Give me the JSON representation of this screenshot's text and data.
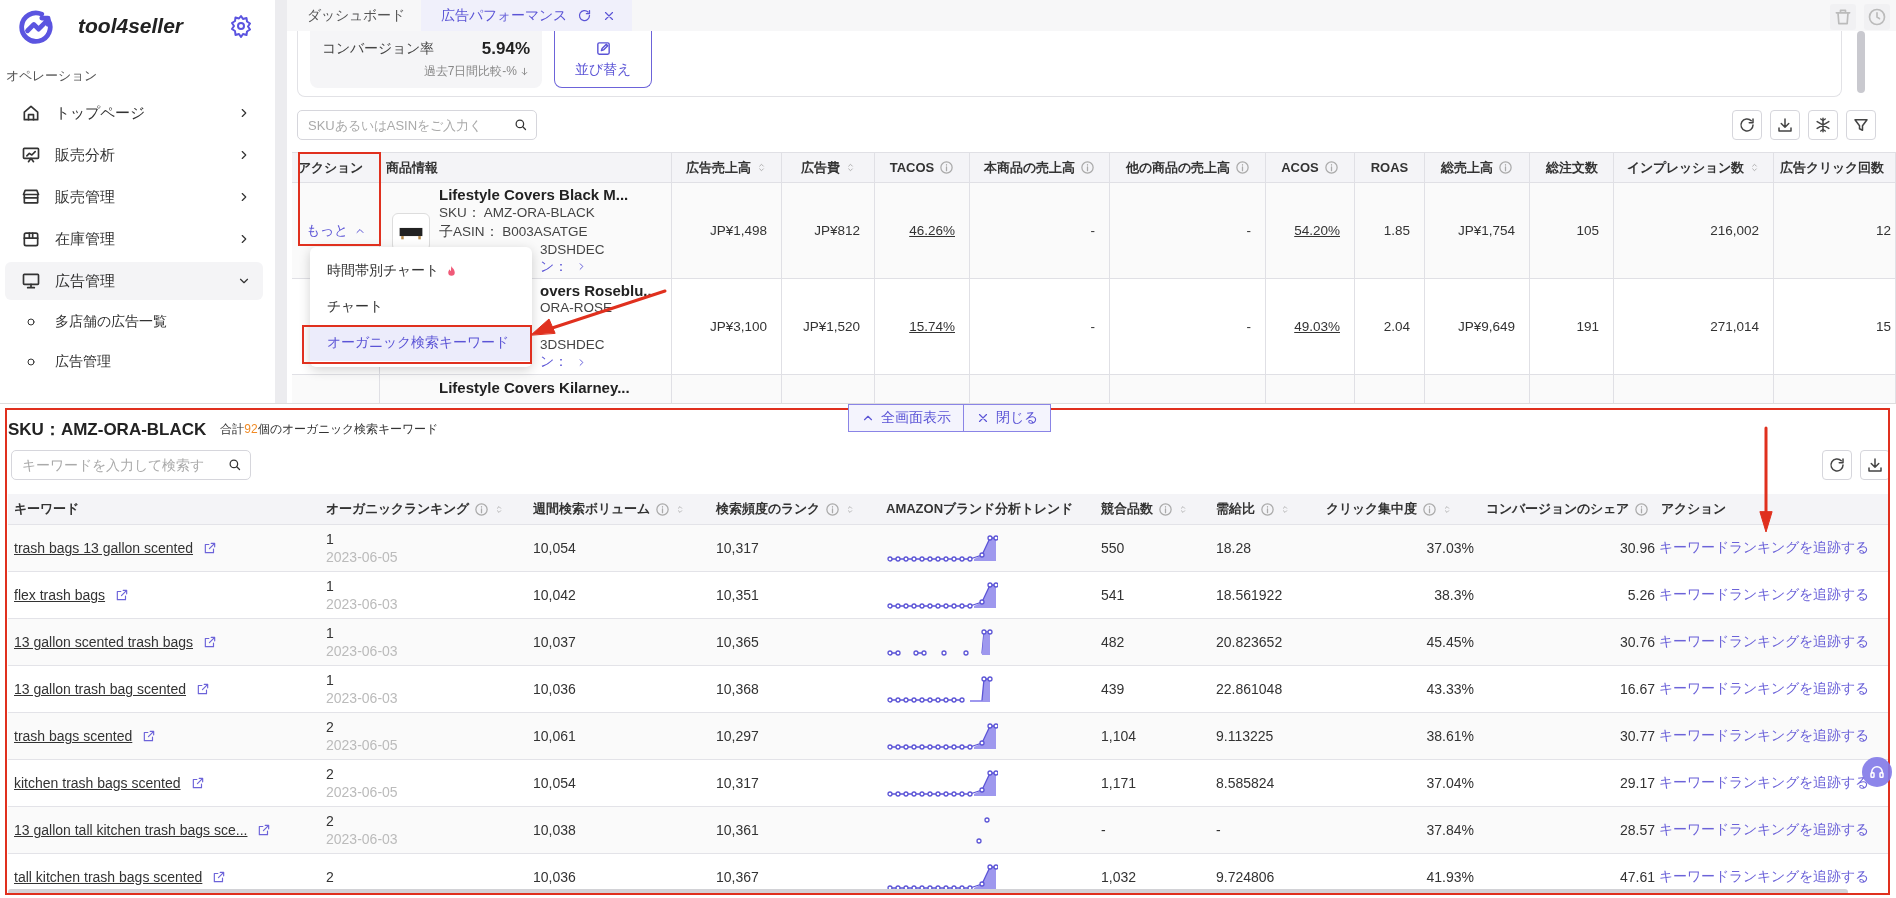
{
  "sidebar": {
    "brand": "tool4seller",
    "section": "オペレーション",
    "items": [
      {
        "label": "トップページ",
        "expanded": false
      },
      {
        "label": "販売分析",
        "expanded": false
      },
      {
        "label": "販売管理",
        "expanded": false
      },
      {
        "label": "在庫管理",
        "expanded": false
      },
      {
        "label": "広告管理",
        "expanded": true,
        "children": [
          {
            "label": "多店舗の広告一覧"
          },
          {
            "label": "広告管理"
          }
        ]
      }
    ]
  },
  "tabs": [
    {
      "label": "ダッシュボード",
      "selected": false
    },
    {
      "label": "広告パフォーマンス",
      "selected": true
    }
  ],
  "metric": {
    "label": "コンバージョン率",
    "value": "5.94%",
    "comparison": "過去7日間比較-%"
  },
  "sort_button": "並び替え",
  "search": {
    "placeholder": "SKUあるいはASINをご入力く"
  },
  "ads_table": {
    "columns": [
      {
        "label": "アクション",
        "info": false,
        "sortable": false
      },
      {
        "label": "商品情報",
        "info": false,
        "sortable": false
      },
      {
        "label": "広告売上高",
        "info": false,
        "sortable": true
      },
      {
        "label": "広告費",
        "info": false,
        "sortable": true
      },
      {
        "label": "TACOS",
        "info": true,
        "sortable": false,
        "linked": true
      },
      {
        "label": "本商品の売上高",
        "info": true,
        "sortable": false
      },
      {
        "label": "他の商品の売上高",
        "info": true,
        "sortable": false
      },
      {
        "label": "ACOS",
        "info": true,
        "sortable": false,
        "linked": true
      },
      {
        "label": "ROAS",
        "info": false,
        "sortable": false
      },
      {
        "label": "総売上高",
        "info": true,
        "sortable": false
      },
      {
        "label": "総注文数",
        "info": false,
        "sortable": false
      },
      {
        "label": "インプレッション数",
        "info": false,
        "sortable": true
      },
      {
        "label": "広告クリック回数",
        "info": false,
        "sortable": false
      }
    ],
    "rows": [
      {
        "action": "もっと",
        "expanded": true,
        "photo": true,
        "lines": [
          {
            "text": "Lifestyle Covers Black M...",
            "kind": "title"
          },
          {
            "text": "SKU： AMZ-ORA-BLACK",
            "kind": "full"
          },
          {
            "text": "子ASIN： B003ASATGE",
            "kind": "full"
          },
          {
            "text": "3DSHDEC",
            "kind": "tail"
          },
          {
            "text": "ン：",
            "kind": "tail-link"
          }
        ],
        "cells": [
          "JP¥1,498",
          "JP¥812",
          "46.26%",
          "-",
          "-",
          "54.20%",
          "1.85",
          "JP¥1,754",
          "105",
          "216,002",
          "12"
        ]
      },
      {
        "lines": [
          {
            "text": "overs Roseblu...",
            "kind": "tail-title"
          },
          {
            "text": "ORA-ROSE",
            "kind": "tail"
          },
          {
            "kind": "covered"
          },
          {
            "text": "3DSHDEC",
            "kind": "tail"
          },
          {
            "text": "ン：",
            "kind": "tail-link"
          }
        ],
        "cells": [
          "JP¥3,100",
          "JP¥1,520",
          "15.74%",
          "-",
          "-",
          "49.03%",
          "2.04",
          "JP¥9,649",
          "191",
          "271,014",
          "15"
        ]
      },
      {
        "lines": [
          {
            "text": "Lifestyle Covers Kilarney...",
            "kind": "title"
          }
        ]
      }
    ]
  },
  "row_menu": {
    "items": [
      {
        "label": "時間帯別チャート",
        "hot": true,
        "selected": false
      },
      {
        "label": "チャート",
        "hot": false,
        "selected": false
      },
      {
        "label": "オーガニック検索キーワード",
        "hot": false,
        "selected": true
      }
    ]
  },
  "keyword_panel": {
    "title": "SKU：AMZ-ORA-BLACK",
    "summary_prefix": "合計",
    "count": "92",
    "summary_suffix": "個のオーガニック検索キーワード",
    "buttons": [
      {
        "label": "全画面表示",
        "kind": "expand"
      },
      {
        "label": "閉じる",
        "kind": "close"
      }
    ],
    "search": {
      "placeholder": "キーワードを入力して検索す"
    },
    "columns": [
      {
        "label": "キーワード",
        "info": false,
        "sortable": false
      },
      {
        "label": "オーガニックランキング",
        "info": true,
        "sortable": true
      },
      {
        "label": "週間検索ボリューム",
        "info": true,
        "sortable": true
      },
      {
        "label": "検索頻度のランク",
        "info": true,
        "sortable": true
      },
      {
        "label": "AMAZONブランド分析トレンド",
        "info": false,
        "sortable": false
      },
      {
        "label": "競合品数",
        "info": true,
        "sortable": true
      },
      {
        "label": "需給比",
        "info": true,
        "sortable": true
      },
      {
        "label": "クリック集中度",
        "info": true,
        "sortable": true
      },
      {
        "label": "コンバージョンのシェア",
        "info": true,
        "sortable": false
      },
      {
        "label": "アクション",
        "info": false,
        "sortable": false
      }
    ],
    "rows": [
      {
        "keyword": "trash bags 13 gallon scented",
        "rank": "1",
        "date": "2023-06-05",
        "weekly_volume": "10,054",
        "frequency_rank": "10,317",
        "kind": "rise",
        "competitors": "550",
        "supply_demand": "18.28",
        "click_concentration": "37.03%",
        "conversion_share": "30.96",
        "action": "キーワードランキングを追跡する"
      },
      {
        "keyword": "flex trash bags",
        "rank": "1",
        "date": "2023-06-03",
        "weekly_volume": "10,042",
        "frequency_rank": "10,351",
        "kind": "rise",
        "competitors": "541",
        "supply_demand": "18.561922",
        "click_concentration": "38.3%",
        "conversion_share": "5.26",
        "action": "キーワードランキングを追跡する"
      },
      {
        "keyword": "13 gallon scented trash bags",
        "rank": "1",
        "date": "2023-06-03",
        "weekly_volume": "10,037",
        "frequency_rank": "10,365",
        "kind": "gaps",
        "competitors": "482",
        "supply_demand": "20.823652",
        "click_concentration": "45.45%",
        "conversion_share": "30.76",
        "action": "キーワードランキングを追跡する"
      },
      {
        "keyword": "13 gallon trash bag scented",
        "rank": "1",
        "date": "2023-06-03",
        "weekly_volume": "10,036",
        "frequency_rank": "10,368",
        "kind": "jump",
        "competitors": "439",
        "supply_demand": "22.861048",
        "click_concentration": "43.33%",
        "conversion_share": "16.67",
        "action": "キーワードランキングを追跡する"
      },
      {
        "keyword": "trash bags scented",
        "rank": "2",
        "date": "2023-06-05",
        "weekly_volume": "10,061",
        "frequency_rank": "10,297",
        "kind": "rise",
        "competitors": "1,104",
        "supply_demand": "9.113225",
        "click_concentration": "38.61%",
        "conversion_share": "30.77",
        "action": "キーワードランキングを追跡する"
      },
      {
        "keyword": "kitchen trash bags scented",
        "rank": "2",
        "date": "2023-06-05",
        "weekly_volume": "10,054",
        "frequency_rank": "10,317",
        "kind": "rise",
        "competitors": "1,171",
        "supply_demand": "8.585824",
        "click_concentration": "37.04%",
        "conversion_share": "29.17",
        "action": "キーワードランキングを追跡する"
      },
      {
        "keyword": "13 gallon tall kitchen trash bags sce...",
        "rank": "2",
        "date": "2023-06-03",
        "weekly_volume": "10,038",
        "frequency_rank": "10,361",
        "kind": "dots",
        "competitors": "-",
        "supply_demand": "-",
        "click_concentration": "37.84%",
        "conversion_share": "28.57",
        "action": "キーワードランキングを追跡する"
      },
      {
        "keyword": "tall kitchen trash bags scented",
        "rank": "2",
        "weekly_volume": "10,036",
        "frequency_rank": "10,367",
        "kind": "rise",
        "competitors": "1,032",
        "supply_demand": "9.724806",
        "click_concentration": "41.93%",
        "conversion_share": "47.61",
        "action": "キーワードランキングを追跡する"
      }
    ]
  }
}
